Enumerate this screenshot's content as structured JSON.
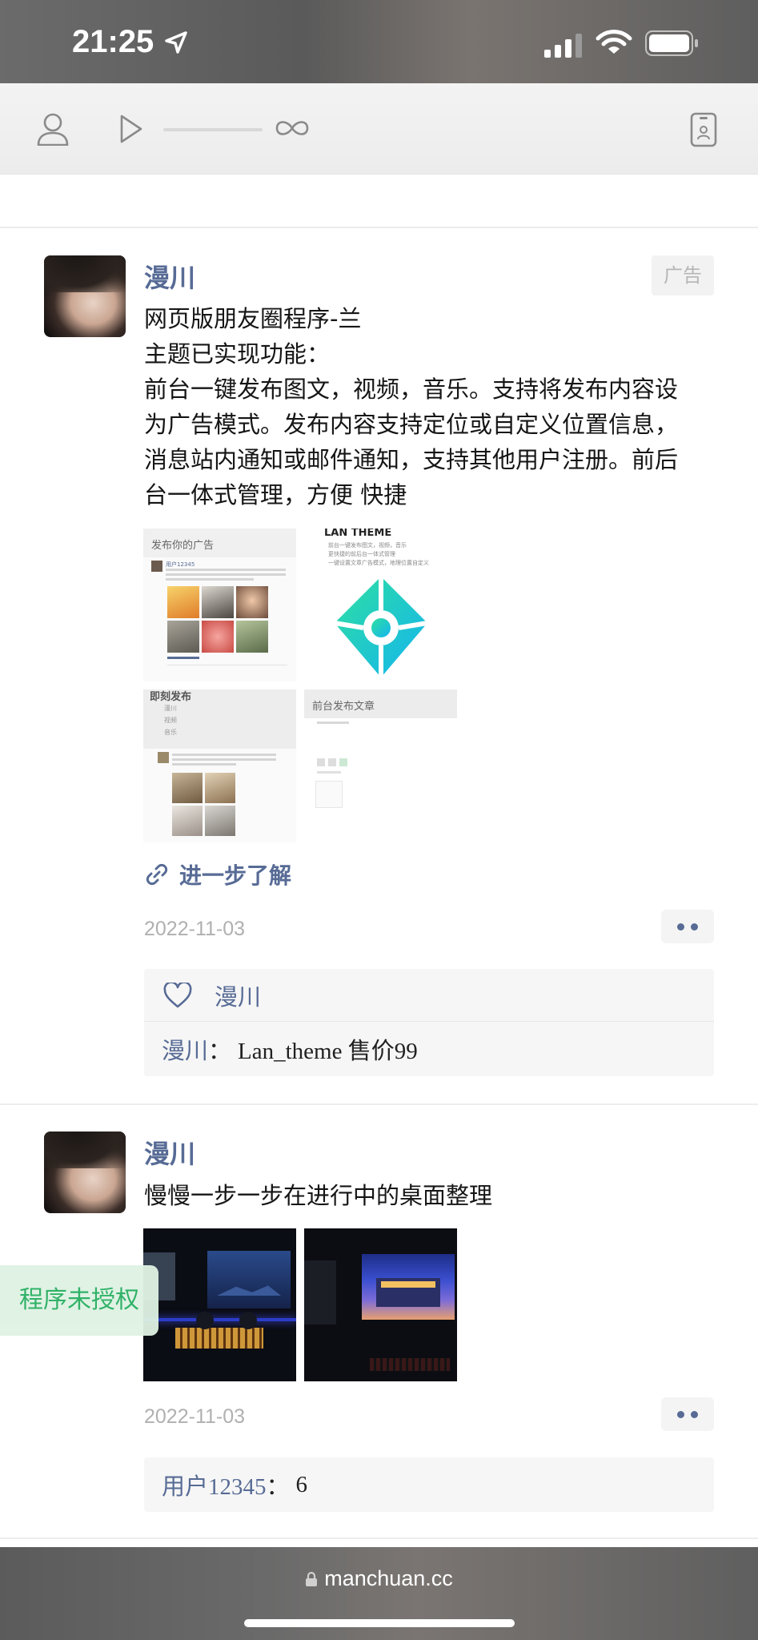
{
  "status_bar": {
    "time": "21:25"
  },
  "toolbar": {
    "icons": [
      "user-icon",
      "play-icon",
      "loop-icon",
      "phone-icon"
    ]
  },
  "posts": [
    {
      "author": "漫川",
      "badge": "广告",
      "lines": [
        "网页版朋友圈程序-兰",
        "主题已实现功能：",
        "前台一键发布图文，视频，音乐。支持将发布内容设",
        "为广告模式。发布内容支持定位或自定义位置信息，",
        "消息站内通知或邮件通知，支持其他用户注册。前后",
        "台一体式管理，方便 快捷"
      ],
      "thumbs": {
        "t1_title": "发布你的广告",
        "t1_user": "用户12345",
        "t2_title": "LAN THEME",
        "t2_lines": [
          "前台一键发布图文，视频，音乐",
          "更快捷的前后台一体式管理",
          "一键设置文章广告模式，地理位置自定义"
        ],
        "t3_title": "即刻发布",
        "t3_items": [
          "漫川",
          "视频",
          "音乐"
        ],
        "t4_title": "前台发布文章"
      },
      "link_label": "进一步了解",
      "date": "2022-11-03",
      "like_name": "漫川",
      "comment": {
        "name": "漫川",
        "sep": "：",
        "text": "Lan_theme 售价99"
      }
    },
    {
      "author": "漫川",
      "lines": [
        "慢慢一步一步在进行中的桌面整理"
      ],
      "date": "2022-11-03",
      "comment": {
        "name": "用户12345",
        "sep": "：",
        "text": "6"
      }
    }
  ],
  "watermark": "程序未授权",
  "address_bar": {
    "url": "manchuan.cc"
  }
}
